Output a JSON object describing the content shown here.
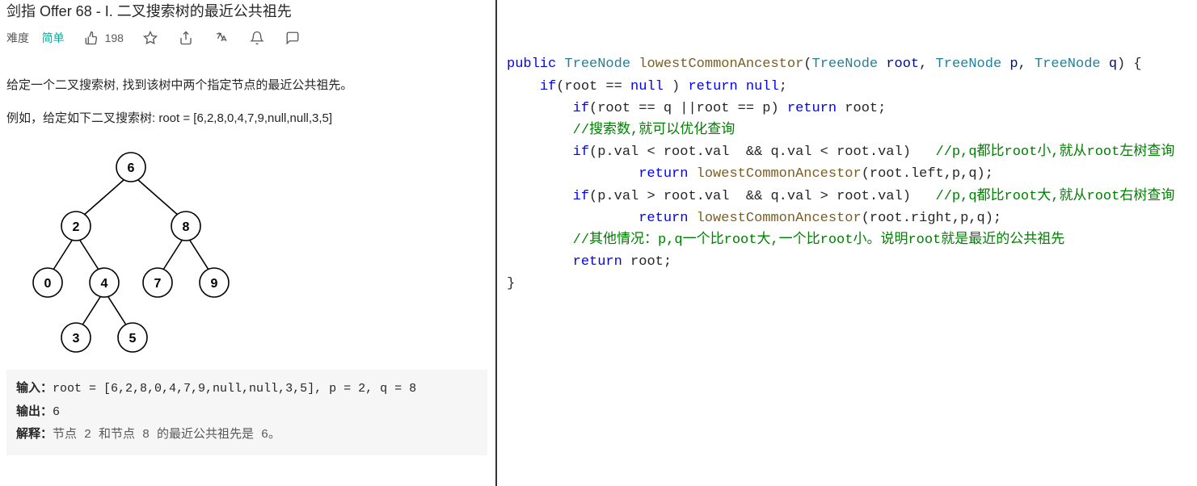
{
  "problem": {
    "title": "剑指 Offer 68 - I. 二叉搜索树的最近公共祖先",
    "difficulty_label": "难度",
    "difficulty_value": "简单",
    "likes": "198",
    "desc_p1": "给定一个二叉搜索树, 找到该树中两个指定节点的最近公共祖先。",
    "desc_p2": "例如，给定如下二叉搜索树:  root = [6,2,8,0,4,7,9,null,null,3,5]",
    "tree_nodes": [
      "6",
      "2",
      "8",
      "0",
      "4",
      "7",
      "9",
      "3",
      "5"
    ],
    "example": {
      "input_label": "输入：",
      "input_value": "root = [6,2,8,0,4,7,9,null,null,3,5], p = 2, q = 8",
      "output_label": "输出：",
      "output_value": "6",
      "explain_label": "解释：",
      "explain_value": "节点 2 和节点 8 的最近公共祖先是 6。"
    }
  },
  "code": {
    "lines": [
      {
        "indent": 0,
        "tokens": [
          {
            "t": "public ",
            "c": "kw"
          },
          {
            "t": "TreeNode ",
            "c": "type"
          },
          {
            "t": "lowestCommonAncestor",
            "c": "method"
          },
          {
            "t": "(",
            "c": ""
          },
          {
            "t": "TreeNode ",
            "c": "type"
          },
          {
            "t": "root",
            "c": "param"
          },
          {
            "t": ", ",
            "c": ""
          },
          {
            "t": "TreeNode ",
            "c": "type"
          },
          {
            "t": "p",
            "c": "param"
          },
          {
            "t": ", ",
            "c": ""
          },
          {
            "t": "TreeNode ",
            "c": "type"
          },
          {
            "t": "q",
            "c": "param"
          },
          {
            "t": ") {",
            "c": ""
          }
        ]
      },
      {
        "indent": 1,
        "tokens": [
          {
            "t": "if",
            "c": "kw"
          },
          {
            "t": "(root == ",
            "c": ""
          },
          {
            "t": "null",
            "c": "lit"
          },
          {
            "t": " ) ",
            "c": ""
          },
          {
            "t": "return ",
            "c": "kw"
          },
          {
            "t": "null",
            "c": "lit"
          },
          {
            "t": ";",
            "c": ""
          }
        ]
      },
      {
        "indent": 2,
        "tokens": [
          {
            "t": "if",
            "c": "kw"
          },
          {
            "t": "(root == q ||root == p) ",
            "c": ""
          },
          {
            "t": "return ",
            "c": "kw"
          },
          {
            "t": "root;",
            "c": ""
          }
        ]
      },
      {
        "indent": 2,
        "tokens": [
          {
            "t": "//搜索数,就可以优化查询",
            "c": "cmt"
          }
        ]
      },
      {
        "indent": 2,
        "tokens": [
          {
            "t": "if",
            "c": "kw"
          },
          {
            "t": "(p.val < root.val  && q.val < root.val)   ",
            "c": ""
          },
          {
            "t": "//p,q都比root小,就从root左树查询",
            "c": "cmt"
          }
        ]
      },
      {
        "indent": 4,
        "tokens": [
          {
            "t": "return ",
            "c": "kw"
          },
          {
            "t": "lowestCommonAncestor",
            "c": "method"
          },
          {
            "t": "(root.left,p,q);",
            "c": ""
          }
        ]
      },
      {
        "indent": 2,
        "tokens": [
          {
            "t": "if",
            "c": "kw"
          },
          {
            "t": "(p.val > root.val  && q.val > root.val)   ",
            "c": ""
          },
          {
            "t": "//p,q都比root大,就从root右树查询",
            "c": "cmt"
          }
        ]
      },
      {
        "indent": 4,
        "tokens": [
          {
            "t": "return ",
            "c": "kw"
          },
          {
            "t": "lowestCommonAncestor",
            "c": "method"
          },
          {
            "t": "(root.right,p,q);",
            "c": ""
          }
        ]
      },
      {
        "indent": 2,
        "tokens": [
          {
            "t": "//其他情况：p,q一个比root大,一个比root小。说明root就是最近的公共祖先",
            "c": "cmt"
          }
        ]
      },
      {
        "indent": 2,
        "tokens": [
          {
            "t": "return ",
            "c": "kw"
          },
          {
            "t": "root;",
            "c": ""
          }
        ]
      },
      {
        "indent": 0,
        "tokens": [
          {
            "t": "}",
            "c": ""
          }
        ]
      }
    ]
  }
}
